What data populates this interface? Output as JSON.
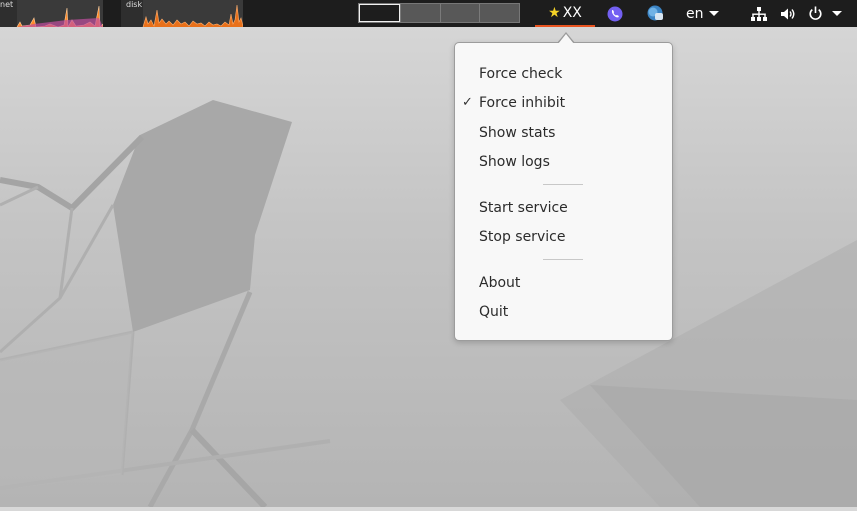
{
  "topbar": {
    "net_label": "net",
    "disk_label": "disk",
    "indicator_text": "XX",
    "language": "en",
    "workspace_count": 4
  },
  "icons": {
    "indicator": "star-icon",
    "viber": "viber-icon",
    "chat": "chat-bubble-icon",
    "network": "network-icon",
    "volume": "volume-icon",
    "power": "power-icon"
  },
  "menu": {
    "items": [
      {
        "label": "Force check",
        "checked": false
      },
      {
        "label": "Force inhibit",
        "checked": true
      },
      {
        "label": "Show stats",
        "checked": false
      },
      {
        "label": "Show logs",
        "checked": false
      },
      {
        "label": "Start service",
        "checked": false
      },
      {
        "label": "Stop service",
        "checked": false
      },
      {
        "label": "About",
        "checked": false
      },
      {
        "label": "Quit",
        "checked": false
      }
    ],
    "check_mark": "✓"
  },
  "colors": {
    "accent": "#e95420",
    "star": "#f5d327",
    "viber": "#7360f2",
    "panel": "#1d1d1d"
  }
}
